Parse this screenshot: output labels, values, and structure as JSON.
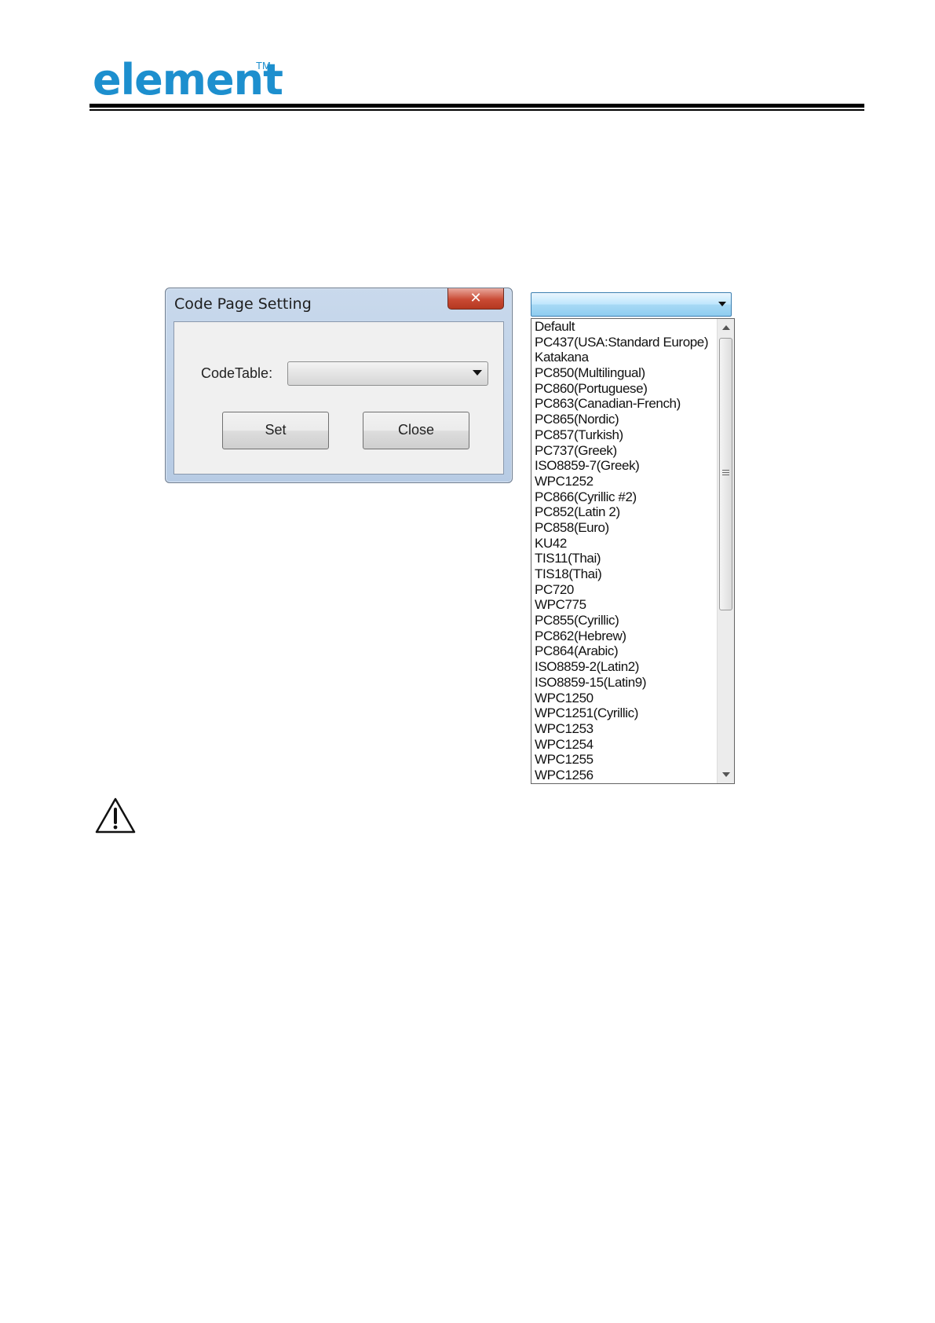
{
  "header": {
    "logo_text": "element",
    "logo_trademark": "TM"
  },
  "dialog": {
    "title": "Code Page Setting",
    "close_glyph": "✕",
    "code_table_label": "CodeTable:",
    "code_table_value": "",
    "set_label": "Set",
    "close_label": "Close"
  },
  "dropdown": {
    "selected": "",
    "items": [
      "Default",
      "PC437(USA:Standard Europe)",
      "Katakana",
      "PC850(Multilingual)",
      "PC860(Portuguese)",
      "PC863(Canadian-French)",
      "PC865(Nordic)",
      "PC857(Turkish)",
      "PC737(Greek)",
      "ISO8859-7(Greek)",
      "WPC1252",
      "PC866(Cyrillic #2)",
      "PC852(Latin 2)",
      "PC858(Euro)",
      "KU42",
      "TIS11(Thai)",
      "TIS18(Thai)",
      "PC720",
      "WPC775",
      "PC855(Cyrillic)",
      "PC862(Hebrew)",
      "PC864(Arabic)",
      "ISO8859-2(Latin2)",
      "ISO8859-15(Latin9)",
      "WPC1250",
      "WPC1251(Cyrillic)",
      "WPC1253",
      "WPC1254",
      "WPC1255",
      "WPC1256"
    ]
  },
  "icons": {
    "warning": "warning-icon",
    "dropdown_arrow": "chevron-down-icon",
    "scroll_up": "scroll-up-icon",
    "scroll_down": "scroll-down-icon"
  },
  "colors": {
    "brand": "#1d8fce",
    "dialog_frame": "#b7cbe4",
    "close_button": "#c94a34",
    "dropdown_header": "#bee6fd"
  }
}
